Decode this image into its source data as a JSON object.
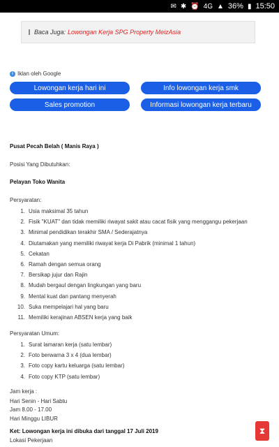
{
  "status": {
    "battery": "36%",
    "time": "15:50",
    "signal": "4G"
  },
  "baca_juga": {
    "label": "Baca Juga:",
    "link": "Lowongan Kerja SPG Property MeizAsia"
  },
  "ads": {
    "label": "Iklan oleh Google",
    "buttons": [
      "Lowongan kerja hari ini",
      "Info lowongan kerja smk",
      "Sales promotion",
      "Informasi lowongan kerja terbaru"
    ]
  },
  "post": {
    "company": "Pusat Pecah Belah ( Manis Raya )",
    "posisi_label": "Posisi Yang Dibutuhkan:",
    "posisi": "Pelayan Toko Wanita",
    "persyaratan_label": "Persyaratan:",
    "persyaratan": [
      "Usia maksimal 35 tahun",
      "Fisik \"KUAT\" dan tidak memiliki riwayat sakit atau cacat fisik yang menggangu pekerjaan",
      "Minimal pendidikan terakhir SMA / Sederajatnya",
      "Diutamakan yang memiliki riwayat kerja Di Pabrik (minimal 1 tahun)",
      "Cekatan",
      "Ramah dengan semua orang",
      "Bersikap jujur dan Rajin",
      "Mudah bergaul dengan lingkungan yang baru",
      "Mental kuat dan pantang menyerah",
      "Suka mempelajari hal yang baru",
      "Memiliki kerajinan ABSEN kerja yang baik"
    ],
    "umum_label": "Persyaratan Umum:",
    "umum": [
      "Surat lamaran kerja (satu lembar)",
      "Foto berwarna 3 x 4 (dua lembar)",
      "Foto copy kartu keluarga (satu lembar)",
      "Foto copy KTP (satu lembar)"
    ],
    "jam_label": "Jam kerja :",
    "jam_hari": "Hari Senin - Hari Sabtu",
    "jam_waktu": "Jam 8.00 - 17.00",
    "jam_libur": "Hari Minggu LIBUR",
    "ket": "Ket: Lowongan kerja ini dibuka dari tanggal 17 Juli 2019",
    "lokasi": "Lokasi Pekerjaan"
  }
}
